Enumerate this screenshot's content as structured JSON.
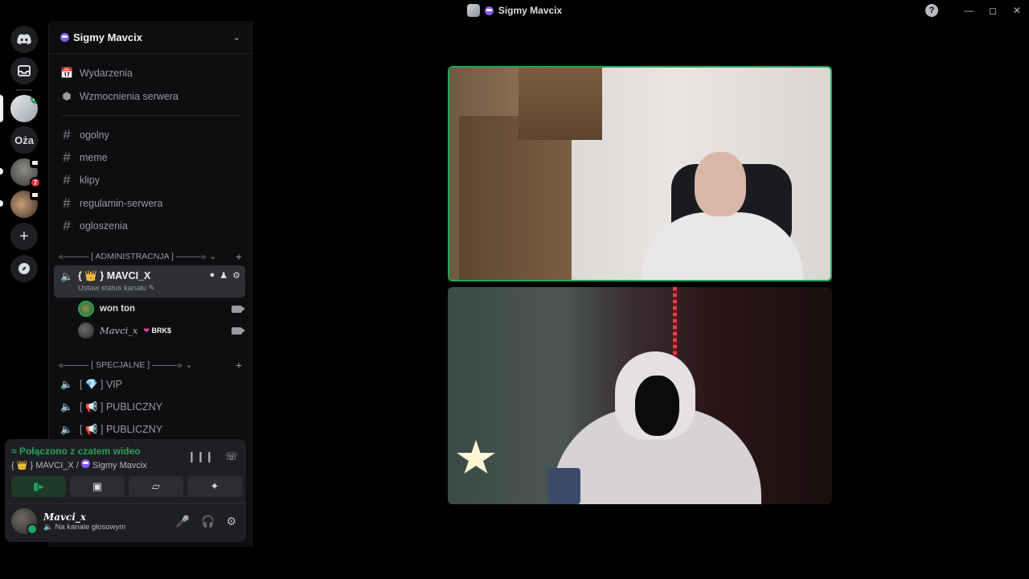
{
  "window": {
    "title": "Sigmy Mavcix"
  },
  "guilds": {
    "items": [
      {
        "name": "discord-home",
        "icon": "discord-logo-icon"
      },
      {
        "name": "inbox",
        "icon": "inbox-icon"
      },
      {
        "name": "sigmy-mavcix",
        "icon": "server-avatar",
        "selected": true
      },
      {
        "name": "oza",
        "label": "Oża"
      },
      {
        "name": "server-4",
        "badge": "7"
      },
      {
        "name": "server-5"
      },
      {
        "name": "add-server",
        "icon": "plus-icon"
      },
      {
        "name": "explore",
        "icon": "compass-icon"
      }
    ]
  },
  "sidebar": {
    "server_name": "Sigmy Mavcix",
    "nav": [
      {
        "label": "Wydarzenia",
        "icon": "calendar-icon"
      },
      {
        "label": "Wzmocnienia serwera",
        "icon": "boost-icon"
      }
    ],
    "channels": [
      {
        "label": "ogolny"
      },
      {
        "label": "meme"
      },
      {
        "label": "klipy"
      },
      {
        "label": "regulamin-serwera"
      },
      {
        "label": "ogloszenia"
      }
    ],
    "category_admin": "«——— [ ADMINISTRACNJA ] ———»",
    "active_voice": {
      "title": "MAVCI_X",
      "status": "Ustaw status kanału",
      "users": [
        {
          "name": "won ton"
        },
        {
          "name": "Mavci_x",
          "tag": "BRK$"
        }
      ]
    },
    "category_special": "«——— [ SPECJALNE ] ———»",
    "voice_channels": [
      {
        "label": "VIP"
      },
      {
        "label": "PUBLICZNY"
      },
      {
        "label": "PUBLICZNY"
      }
    ]
  },
  "voice_panel": {
    "connected": "Połączono z czatem wideo",
    "location_channel": "MAVCI_X /",
    "location_server": "Sigmy Mavcix",
    "user_name": "Mavci_x",
    "user_status": "Na kanale głosowym"
  },
  "colors": {
    "accent_green": "#23a55a",
    "badge_red": "#da373c",
    "background": "#000000"
  }
}
